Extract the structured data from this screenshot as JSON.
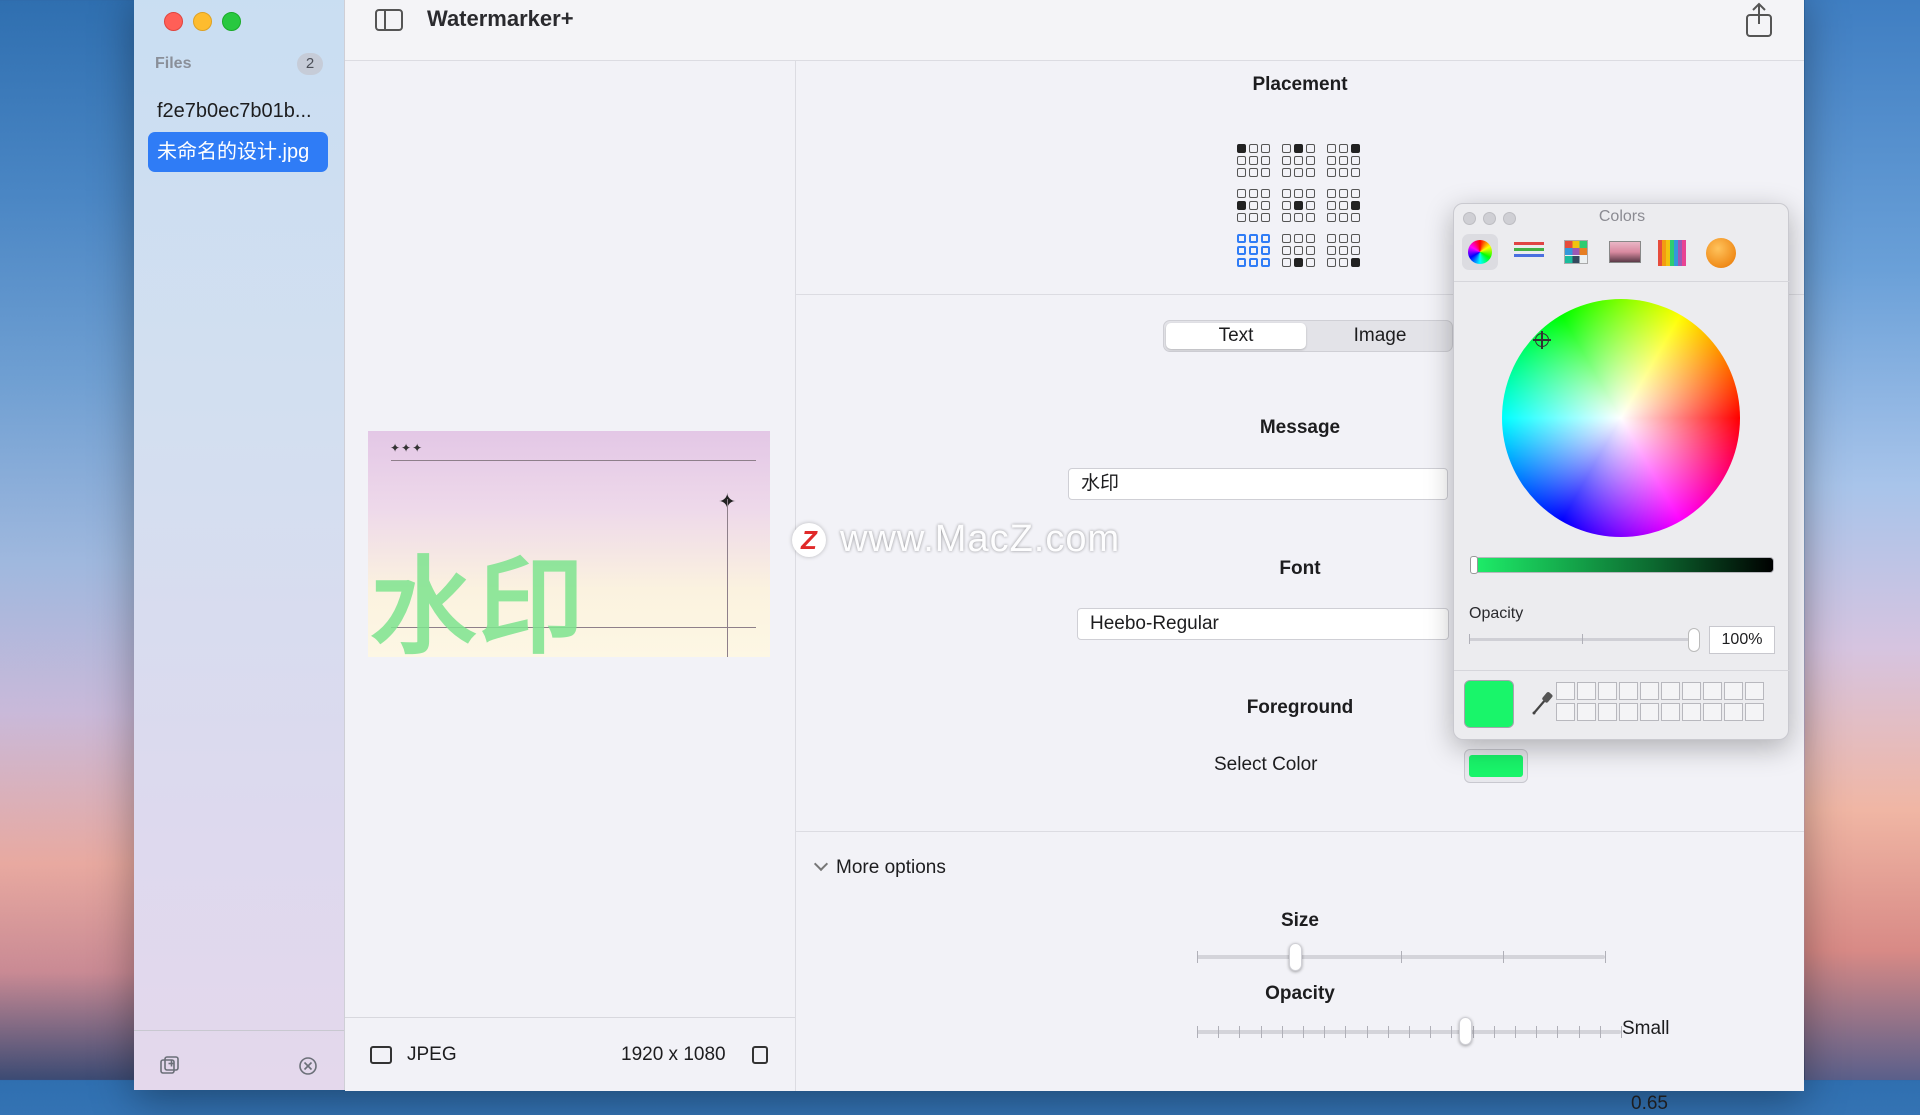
{
  "window": {
    "title": "Watermarker+"
  },
  "sidebar": {
    "files_label": "Files",
    "files_count": "2",
    "files": [
      {
        "name": "f2e7b0ec7b01b..."
      },
      {
        "name": "未命名的设计.jpg"
      }
    ]
  },
  "preview": {
    "watermark_text": "水印",
    "decor_stars": "✦✦✦",
    "file_type": "JPEG",
    "dimensions": "1920 x 1080"
  },
  "placement": {
    "title": "Placement"
  },
  "tabs": {
    "text_label": "Text",
    "image_label": "Image",
    "active": "Text"
  },
  "message": {
    "title": "Message",
    "value": "水印"
  },
  "font": {
    "title": "Font",
    "value": "Heebo-Regular"
  },
  "foreground": {
    "title": "Foreground",
    "select_label": "Select Color",
    "color": "#19f56a"
  },
  "more_options": {
    "label": "More options",
    "size_title": "Size",
    "size_value_label": "Small",
    "size_fraction": 0.25,
    "opacity_title": "Opacity",
    "opacity_value": "0.65"
  },
  "colors_panel": {
    "title": "Colors",
    "opacity_label": "Opacity",
    "opacity_value": "100%",
    "current_color": "#19f56a",
    "modes": [
      "color-wheel-icon",
      "color-sliders-icon",
      "color-palettes-icon",
      "image-palettes-icon",
      "pencils-icon",
      "orange-crayon-icon"
    ]
  },
  "overlay": {
    "watermark": "www.MacZ.com",
    "logo_letter": "Z"
  }
}
